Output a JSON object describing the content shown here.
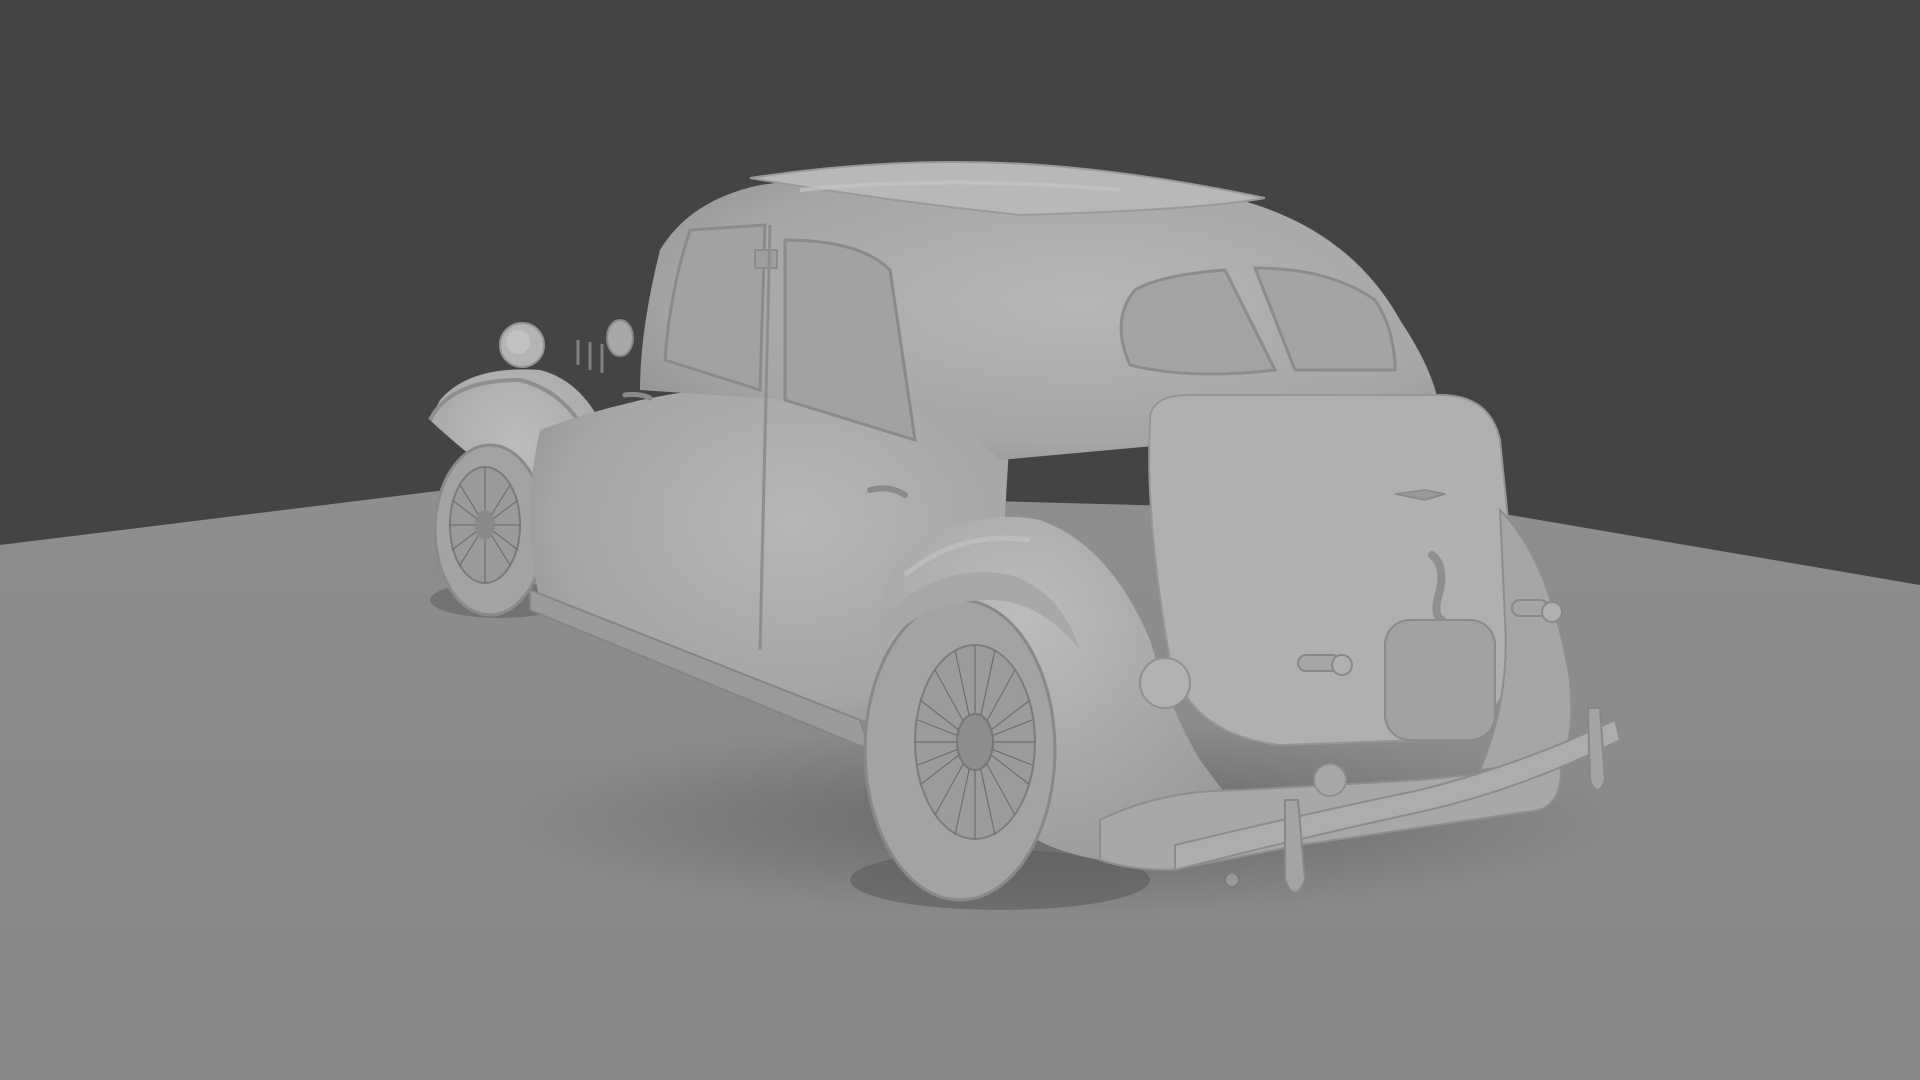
{
  "scene": {
    "subject": "vintage-sedan-clay-render",
    "colors": {
      "background": "#444444",
      "floor": "#8a8a8a",
      "floor_near": "#888888",
      "car_body": "#a9a9a9",
      "car_highlight": "#bdbdbd",
      "car_shadow": "#8c8c8c",
      "window": "#9d9d9d",
      "tire": "#9c9c9c",
      "spokes": "#6e6e6e"
    }
  }
}
